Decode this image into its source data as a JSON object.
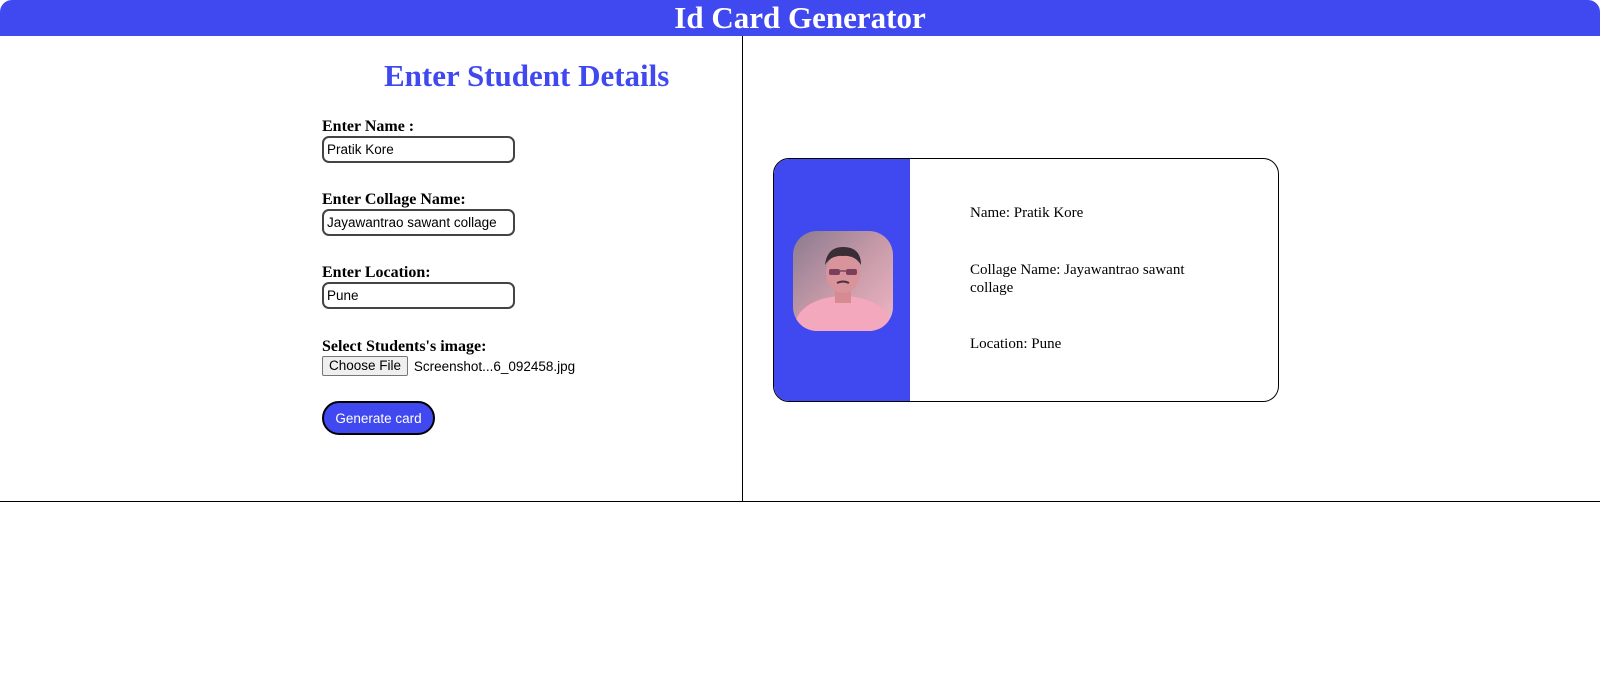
{
  "header": {
    "title": "Id Card Generator"
  },
  "form": {
    "title": "Enter Student Details",
    "name_label": "Enter Name :",
    "name_value": "Pratik Kore",
    "college_label": "Enter Collage Name:",
    "college_value": "Jayawantrao sawant collage",
    "location_label": "Enter Location:",
    "location_value": "Pune",
    "image_label": "Select Students's image:",
    "choose_file_label": "Choose File",
    "file_name": "Screenshot...6_092458.jpg",
    "generate_label": "Generate card"
  },
  "card": {
    "name_text": "Name: Pratik Kore",
    "college_text": "Collage Name: Jayawantrao sawant collage",
    "location_text": "Location: Pune",
    "photo_icon": "student-photo"
  },
  "colors": {
    "accent": "#4048F0",
    "text": "#000000",
    "background": "#FFFFFF"
  }
}
